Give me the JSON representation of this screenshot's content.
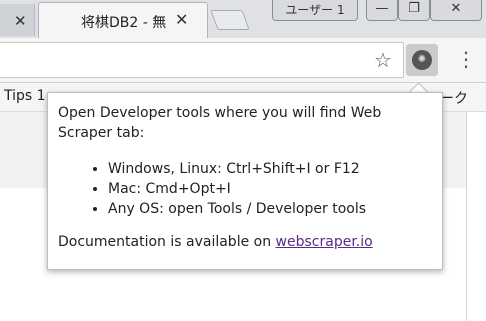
{
  "tabs": {
    "inactive_fragment": "",
    "active_title": "将棋DB2 - 無",
    "close_glyph": "✕"
  },
  "window": {
    "user_label": "ユーザー 1",
    "minimize": "—",
    "restore": "❐",
    "close": "✕"
  },
  "toolbar": {
    "star_glyph": "☆",
    "extension_glyph": "✺",
    "menu_glyph": "⋮"
  },
  "bookmarks": {
    "left_item": "Tips 1",
    "right_item": "ーク"
  },
  "popup": {
    "intro": "Open Developer tools where you will find Web Scraper tab:",
    "items": [
      "Windows, Linux: Ctrl+Shift+I or F12",
      "Mac: Cmd+Opt+I",
      "Any OS: open Tools / Developer tools"
    ],
    "doc_prefix": "Documentation is available on ",
    "doc_link": "webscraper.io"
  }
}
